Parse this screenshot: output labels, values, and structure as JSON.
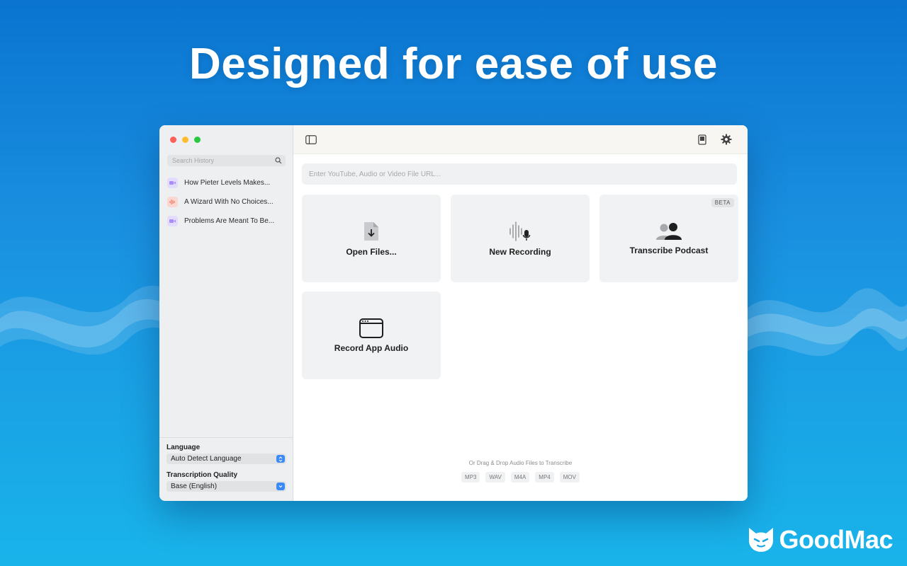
{
  "headline": "Designed for ease of use",
  "window": {
    "sidebar": {
      "search_placeholder": "Search History",
      "history": [
        {
          "title": "How Pieter Levels Makes...",
          "icon": "video-icon"
        },
        {
          "title": "A Wizard With No Choices...",
          "icon": "audio-wave-icon"
        },
        {
          "title": "Problems Are Meant To Be...",
          "icon": "video-icon"
        }
      ],
      "language_label": "Language",
      "language_value": "Auto Detect Language",
      "quality_label": "Transcription Quality",
      "quality_value": "Base (English)"
    },
    "main": {
      "url_placeholder": "Enter YouTube, Audio or Video File URL...",
      "cards": [
        {
          "label": "Open Files...",
          "icon": "file-download-icon"
        },
        {
          "label": "New Recording",
          "icon": "microphone-wave-icon"
        },
        {
          "label": "Transcribe Podcast",
          "icon": "people-icon",
          "badge": "BETA"
        },
        {
          "label": "Record App Audio",
          "icon": "app-window-icon"
        }
      ],
      "drop_hint": "Or Drag & Drop Audio Files to Transcribe",
      "formats": [
        "MP3",
        "WAV",
        "M4A",
        "MP4",
        "MOV"
      ]
    }
  },
  "brand": {
    "name": "GoodMac"
  },
  "colors": {
    "background_top": "#0a74d0",
    "background_bottom": "#19b4ea",
    "accent_select": "#3c8af5",
    "traffic_red": "#fe5f57",
    "traffic_yellow": "#febc2e",
    "traffic_green": "#28c840"
  }
}
